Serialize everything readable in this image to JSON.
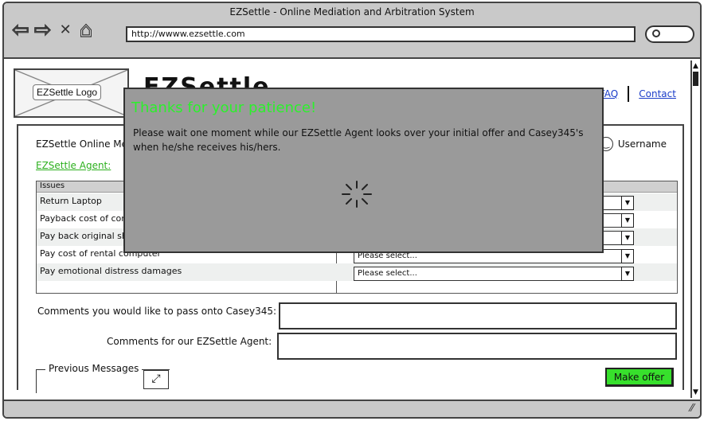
{
  "browser": {
    "window_title": "EZSettle - Online Mediation and Arbitration System",
    "url": "http://wwww.ezsettle.com"
  },
  "header": {
    "logo_label": "EZSettle Logo",
    "big_title": "EZSettle",
    "links": [
      "FAQ",
      "Contact"
    ]
  },
  "panel": {
    "title": "EZSettle Online Mediation",
    "agent_link": "EZSettle Agent:",
    "username": "Username"
  },
  "issues_table": {
    "header": "Issues",
    "rows": [
      {
        "label": "Return Laptop",
        "select": ""
      },
      {
        "label": "Payback cost of computer",
        "select": ""
      },
      {
        "label": "Pay back original shipping",
        "select": ""
      },
      {
        "label": "Pay cost of rental computer",
        "select": "Please select..."
      },
      {
        "label": "Pay emotional distress damages",
        "select": "Please select..."
      }
    ]
  },
  "comments": {
    "to_party_label": "Comments you would like to pass onto Casey345:",
    "to_agent_label": "Comments for our EZSettle Agent:"
  },
  "previous_messages_label": "Previous Messages",
  "make_offer_label": "Make offer",
  "modal": {
    "title": "Thanks for your patience!",
    "text": "Please wait one moment while our EZSettle Agent looks over your initial offer and Casey345's when he/she receives his/hers."
  },
  "colors": {
    "accent_green": "#37e02c",
    "modal_bg": "#9a9a9a",
    "link_blue": "#1a3cc9"
  }
}
